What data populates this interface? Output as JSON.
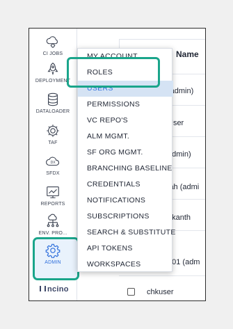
{
  "sidebar": {
    "items": [
      {
        "label": "CI JOBS",
        "icon": "cloud-gear-icon"
      },
      {
        "label": "DEPLOYMENT",
        "icon": "rocket-icon"
      },
      {
        "label": "DATALOADER",
        "icon": "database-icon"
      },
      {
        "label": "TAF",
        "icon": "gear-icon"
      },
      {
        "label": "SFDX",
        "icon": "dx-cloud-icon"
      },
      {
        "label": "REPORTS",
        "icon": "report-chart-icon"
      },
      {
        "label": "ENV. PRO...",
        "icon": "network-icon"
      },
      {
        "label": "ADMIN",
        "icon": "admin-gear-icon"
      }
    ],
    "active": "ADMIN",
    "brand": "ncino"
  },
  "table": {
    "column_header": "Name",
    "rows": [
      "(admin)",
      "User",
      "admin)",
      "iah (admi",
      "akanth",
      "001 (adm",
      "chkuser"
    ]
  },
  "dropdown": {
    "items": [
      "MY ACCOUNT",
      "ROLES",
      "USERS",
      "PERMISSIONS",
      "VC REPO'S",
      "ALM MGMT.",
      "SF ORG MGMT.",
      "BRANCHING BASELINE",
      "CREDENTIALS",
      "NOTIFICATIONS",
      "SUBSCRIPTIONS",
      "SEARCH & SUBSTITUTE",
      "API TOKENS",
      "WORKSPACES"
    ],
    "highlighted": "USERS"
  },
  "colors": {
    "accent": "#1aa58b",
    "active_blue": "#2f6fdc",
    "selected_bg": "#d5e3f4"
  }
}
